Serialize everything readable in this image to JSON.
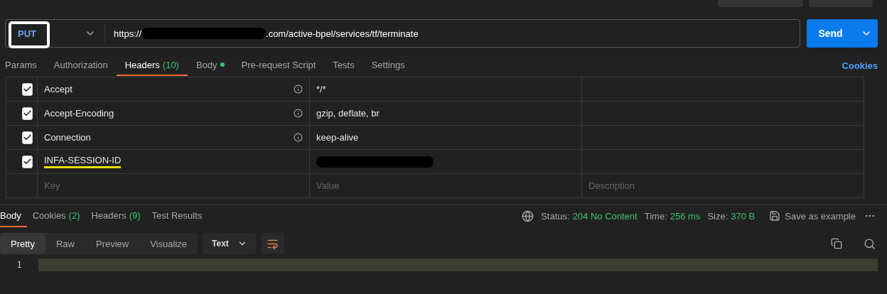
{
  "request": {
    "method": "PUT",
    "url_start": "https://",
    "url_redacted": true,
    "url_end": ".com/active-bpel/services/tf/terminate",
    "send": "Send"
  },
  "request_tabs": [
    {
      "label": "Params",
      "selected": false
    },
    {
      "label": "Authorization",
      "selected": false
    },
    {
      "label": "Headers",
      "count": "(10)",
      "selected": true
    },
    {
      "label": "Body",
      "dot": true,
      "selected": false
    },
    {
      "label": "Pre-request Script",
      "selected": false
    },
    {
      "label": "Tests",
      "selected": false
    },
    {
      "label": "Settings",
      "selected": false
    }
  ],
  "cookies_link": "Cookies",
  "headers": [
    {
      "checked": true,
      "key": "Accept",
      "info": true,
      "value": "*/*",
      "highlighted": false
    },
    {
      "checked": true,
      "key": "Accept-Encoding",
      "info": true,
      "value": "gzip, deflate, br",
      "highlighted": false
    },
    {
      "checked": true,
      "key": "Connection",
      "info": true,
      "value": "keep-alive",
      "highlighted": false
    },
    {
      "checked": true,
      "key": "INFA-SESSION-ID",
      "info": false,
      "value_redacted": true,
      "highlighted": true
    }
  ],
  "new_header": {
    "key": {
      "placeholder": "Key"
    },
    "value": {
      "placeholder": "Value"
    },
    "description": {
      "placeholder": "Description"
    }
  },
  "response_tabs": [
    {
      "label": "Body",
      "selected": true
    },
    {
      "label": "Cookies",
      "count": "(2)",
      "selected": false
    },
    {
      "label": "Headers",
      "count": "(9)",
      "selected": false
    },
    {
      "label": "Test Results",
      "selected": false
    }
  ],
  "status": [
    {
      "label": "Status:",
      "value": "204 No Content"
    },
    {
      "label": "Time:",
      "value": "256 ms"
    },
    {
      "label": "Size:",
      "value": "370 B"
    }
  ],
  "save_example": "Save as example",
  "view_modes": [
    {
      "label": "Pretty",
      "selected": true
    },
    {
      "label": "Raw",
      "selected": false
    },
    {
      "label": "Preview",
      "selected": false
    },
    {
      "label": "Visualize",
      "selected": false
    }
  ],
  "format": "Text",
  "line_numbers": [
    "1"
  ]
}
